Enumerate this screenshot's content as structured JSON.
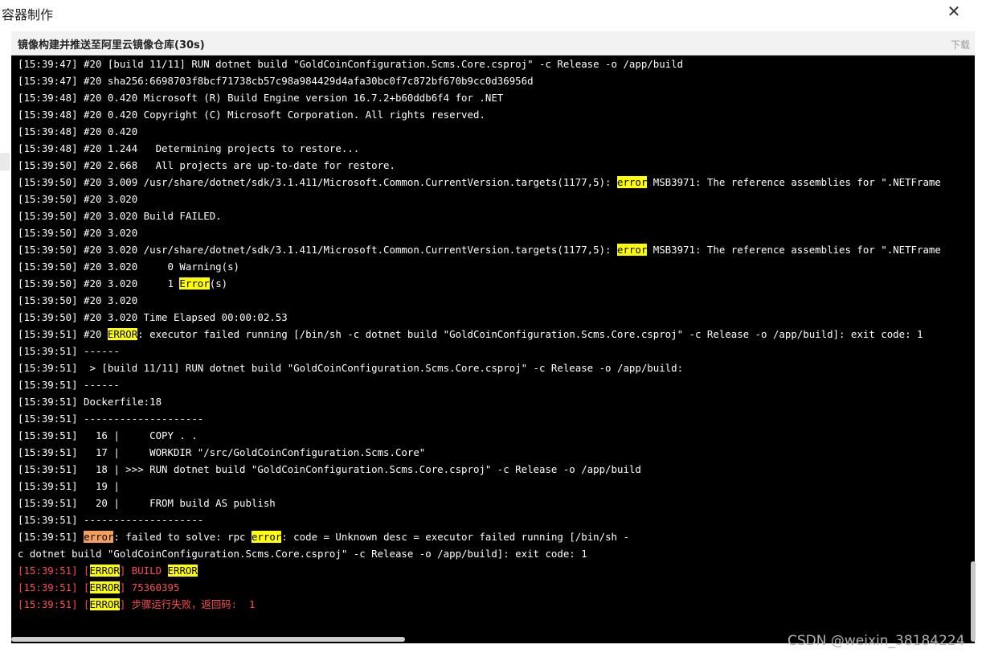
{
  "dialog": {
    "title": "容器制作",
    "close_icon": "close-icon"
  },
  "panel": {
    "title": "镜像构建并推送至阿里云镜像仓库(30s)",
    "download_label": "下载"
  },
  "colors": {
    "highlight_yellow": "#ffff00",
    "highlight_orange": "#f59f5a",
    "error_text": "#ff4d4f"
  },
  "log_lines": [
    {
      "color": "white",
      "segments": [
        {
          "t": "[15:39:47] #20 [build 11/11] RUN dotnet build \"GoldCoinConfiguration.Scms.Core.csproj\" -c Release -o /app/build"
        }
      ]
    },
    {
      "color": "white",
      "segments": [
        {
          "t": "[15:39:47] #20 sha256:6698703f8bcf71738cb57c98a984429d4afa30bc0f7c872bf670b9cc0d36956d"
        }
      ]
    },
    {
      "color": "white",
      "segments": [
        {
          "t": "[15:39:48] #20 0.420 Microsoft (R) Build Engine version 16.7.2+b60ddb6f4 for .NET"
        }
      ]
    },
    {
      "color": "white",
      "segments": [
        {
          "t": "[15:39:48] #20 0.420 Copyright (C) Microsoft Corporation. All rights reserved."
        }
      ]
    },
    {
      "color": "white",
      "segments": [
        {
          "t": "[15:39:48] #20 0.420"
        }
      ]
    },
    {
      "color": "white",
      "segments": [
        {
          "t": "[15:39:48] #20 1.244   Determining projects to restore..."
        }
      ]
    },
    {
      "color": "white",
      "segments": [
        {
          "t": "[15:39:50] #20 2.668   All projects are up-to-date for restore."
        }
      ]
    },
    {
      "color": "white",
      "segments": [
        {
          "t": "[15:39:50] #20 3.009 /usr/share/dotnet/sdk/3.1.411/Microsoft.Common.CurrentVersion.targets(1177,5): "
        },
        {
          "t": "error",
          "hl": "yellow"
        },
        {
          "t": " MSB3971: The reference assemblies for \".NETFrame"
        }
      ]
    },
    {
      "color": "white",
      "segments": [
        {
          "t": "[15:39:50] #20 3.020"
        }
      ]
    },
    {
      "color": "white",
      "segments": [
        {
          "t": "[15:39:50] #20 3.020 Build FAILED."
        }
      ]
    },
    {
      "color": "white",
      "segments": [
        {
          "t": "[15:39:50] #20 3.020"
        }
      ]
    },
    {
      "color": "white",
      "segments": [
        {
          "t": "[15:39:50] #20 3.020 /usr/share/dotnet/sdk/3.1.411/Microsoft.Common.CurrentVersion.targets(1177,5): "
        },
        {
          "t": "error",
          "hl": "yellow"
        },
        {
          "t": " MSB3971: The reference assemblies for \".NETFrame"
        }
      ]
    },
    {
      "color": "white",
      "segments": [
        {
          "t": "[15:39:50] #20 3.020     0 Warning(s)"
        }
      ]
    },
    {
      "color": "white",
      "segments": [
        {
          "t": "[15:39:50] #20 3.020     1 "
        },
        {
          "t": "Error",
          "hl": "yellow"
        },
        {
          "t": "(s)"
        }
      ]
    },
    {
      "color": "white",
      "segments": [
        {
          "t": "[15:39:50] #20 3.020"
        }
      ]
    },
    {
      "color": "white",
      "segments": [
        {
          "t": "[15:39:50] #20 3.020 Time Elapsed 00:00:02.53"
        }
      ]
    },
    {
      "color": "white",
      "segments": [
        {
          "t": "[15:39:51] #20 "
        },
        {
          "t": "ERROR",
          "hl": "yellow"
        },
        {
          "t": ": executor failed running [/bin/sh -c dotnet build \"GoldCoinConfiguration.Scms.Core.csproj\" -c Release -o /app/build]: exit code: 1"
        }
      ]
    },
    {
      "color": "white",
      "segments": [
        {
          "t": "[15:39:51] ------"
        }
      ]
    },
    {
      "color": "white",
      "segments": [
        {
          "t": "[15:39:51]  > [build 11/11] RUN dotnet build \"GoldCoinConfiguration.Scms.Core.csproj\" -c Release -o /app/build:"
        }
      ]
    },
    {
      "color": "white",
      "segments": [
        {
          "t": "[15:39:51] ------"
        }
      ]
    },
    {
      "color": "white",
      "segments": [
        {
          "t": "[15:39:51] Dockerfile:18"
        }
      ]
    },
    {
      "color": "white",
      "segments": [
        {
          "t": "[15:39:51] --------------------"
        }
      ]
    },
    {
      "color": "white",
      "segments": [
        {
          "t": "[15:39:51]   16 |     COPY . ."
        }
      ]
    },
    {
      "color": "white",
      "segments": [
        {
          "t": "[15:39:51]   17 |     WORKDIR \"/src/GoldCoinConfiguration.Scms.Core\""
        }
      ]
    },
    {
      "color": "white",
      "segments": [
        {
          "t": "[15:39:51]   18 | >>> RUN dotnet build \"GoldCoinConfiguration.Scms.Core.csproj\" -c Release -o /app/build"
        }
      ]
    },
    {
      "color": "white",
      "segments": [
        {
          "t": "[15:39:51]   19 |"
        }
      ]
    },
    {
      "color": "white",
      "segments": [
        {
          "t": "[15:39:51]   20 |     FROM build AS publish"
        }
      ]
    },
    {
      "color": "white",
      "segments": [
        {
          "t": "[15:39:51] --------------------"
        }
      ]
    },
    {
      "color": "white",
      "segments": [
        {
          "t": "[15:39:51] "
        },
        {
          "t": "error",
          "hl": "orange"
        },
        {
          "t": ": failed to solve: rpc "
        },
        {
          "t": "error",
          "hl": "yellow"
        },
        {
          "t": ": code = Unknown desc = executor failed running [/bin/sh -"
        }
      ]
    },
    {
      "color": "white",
      "segments": [
        {
          "t": "c dotnet build \"GoldCoinConfiguration.Scms.Core.csproj\" -c Release -o /app/build]: exit code: 1"
        }
      ]
    },
    {
      "color": "red",
      "segments": [
        {
          "t": "[15:39:51] ["
        },
        {
          "t": "ERROR",
          "hl": "yellow"
        },
        {
          "t": "] BUILD "
        },
        {
          "t": "ERROR",
          "hl": "yellow"
        }
      ]
    },
    {
      "color": "red",
      "segments": [
        {
          "t": "[15:39:51] ["
        },
        {
          "t": "ERROR",
          "hl": "yellow"
        },
        {
          "t": "] 75360395"
        }
      ]
    },
    {
      "color": "red",
      "segments": [
        {
          "t": "[15:39:51] ["
        },
        {
          "t": "ERROR",
          "hl": "yellow"
        },
        {
          "t": "] 步骤运行失败，返回码:  1"
        }
      ]
    }
  ],
  "watermark": "CSDN @weixin_38184224"
}
